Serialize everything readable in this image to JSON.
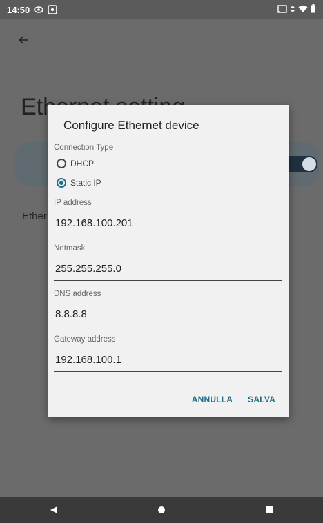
{
  "status_bar": {
    "time": "14:50",
    "left_icons": [
      "eye-icon",
      "screen-record-icon"
    ],
    "right_icons": [
      "cast-icon",
      "data-arrows-icon",
      "wifi-icon",
      "battery-icon"
    ]
  },
  "page": {
    "title": "Ethernet setting",
    "subtitle": "Ether",
    "toggle_on": true
  },
  "dialog": {
    "title": "Configure Ethernet device",
    "connection_type_label": "Connection Type",
    "options": [
      {
        "label": "DHCP",
        "selected": false
      },
      {
        "label": "Static IP",
        "selected": true
      }
    ],
    "fields": [
      {
        "label": "IP address",
        "value": "192.168.100.201"
      },
      {
        "label": "Netmask",
        "value": "255.255.255.0"
      },
      {
        "label": "DNS address",
        "value": "8.8.8.8"
      },
      {
        "label": "Gateway address",
        "value": "192.168.100.1"
      }
    ],
    "cancel_label": "ANNULLA",
    "save_label": "SALVA"
  },
  "colors": {
    "accent": "#1f6f86",
    "scrim": "#6b6b6b"
  }
}
